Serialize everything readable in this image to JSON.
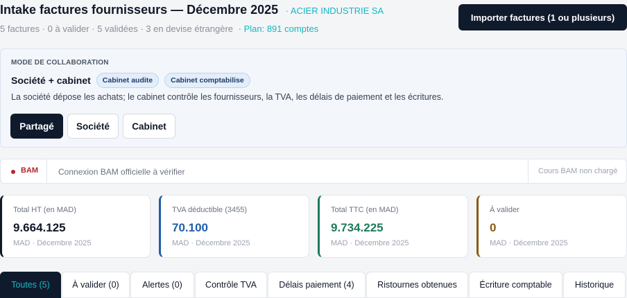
{
  "header": {
    "title": "Intake factures fournisseurs — Décembre 2025",
    "company": "· ACIER INDUSTRIE SA",
    "summary": "5 factures · 0 à valider · 5 validées · 3 en devise étrangère",
    "plan": "· Plan: 891 comptes",
    "import_label": "Importer factures (1 ou plusieurs)"
  },
  "collab": {
    "heading": "MODE DE COLLABORATION",
    "mode_name": "Société + cabinet",
    "tags": [
      "Cabinet audite",
      "Cabinet comptabilise"
    ],
    "description": "La société dépose les achats; le cabinet contrôle les fournisseurs, la TVA, les délais de paiement et les écritures.",
    "options": [
      "Partagé",
      "Société",
      "Cabinet"
    ],
    "selected": "Partagé"
  },
  "bam": {
    "label": "BAM",
    "status": "Connexion BAM officielle à vérifier",
    "rate": "Cours BAM non chargé"
  },
  "kpis": [
    {
      "label": "Total HT (en MAD)",
      "value": "9.664.125",
      "sub": "MAD · Décembre 2025",
      "color": "#111827"
    },
    {
      "label": "TVA déductible (3455)",
      "value": "70.100",
      "sub": "MAD · Décembre 2025",
      "color": "#1f5ea8"
    },
    {
      "label": "Total TTC (en MAD)",
      "value": "9.734.225",
      "sub": "MAD · Décembre 2025",
      "color": "#1f7a5a"
    },
    {
      "label": "À valider",
      "value": "0",
      "sub": "MAD · Décembre 2025",
      "color": "#8a5a12"
    }
  ],
  "tabs": [
    "Toutes (5)",
    "À valider (0)",
    "Alertes (0)",
    "Contrôle TVA",
    "Délais paiement (4)",
    "Ristournes obtenues",
    "Écriture comptable",
    "Historique"
  ],
  "active_tab": "Toutes (5)",
  "colors": {
    "navy": "#0f1b2d",
    "teal": "#14b8c4",
    "alert_red": "#b3262e"
  }
}
